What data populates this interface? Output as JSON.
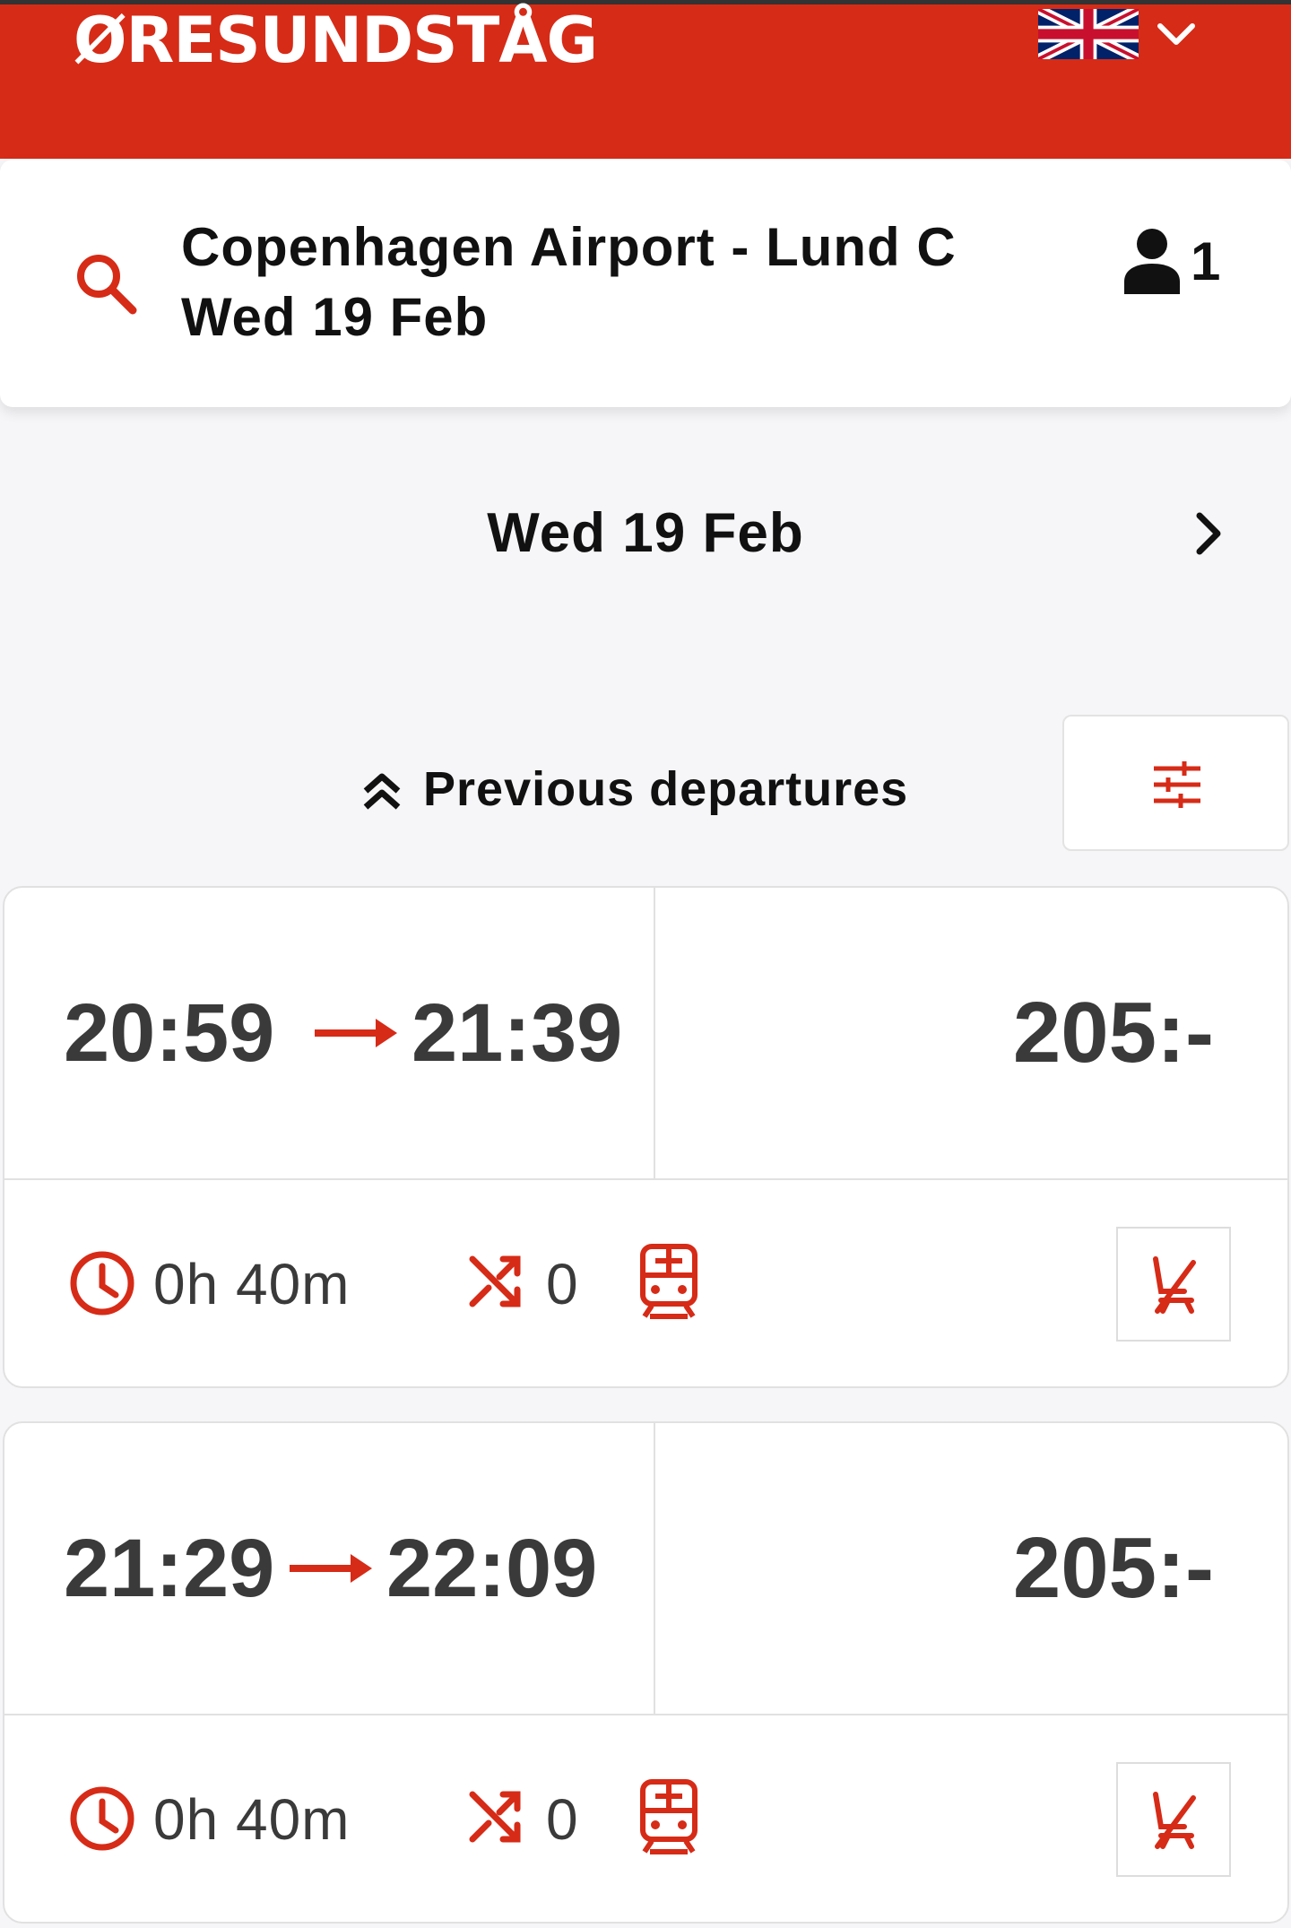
{
  "header": {
    "logo": "ØRESUNDSTÅG",
    "language_flag": "uk-flag-icon",
    "language_chevron": "chevron-down-icon"
  },
  "search": {
    "route": "Copenhagen Airport - Lund C",
    "date": "Wed 19 Feb",
    "passengers": "1"
  },
  "date_nav": {
    "current_date": "Wed 19 Feb"
  },
  "previous_departures_label": "Previous departures",
  "trips": [
    {
      "departure": "20:59",
      "arrival": "21:39",
      "price": "205:-",
      "duration": "0h 40m",
      "changes": "0"
    },
    {
      "departure": "21:29",
      "arrival": "22:09",
      "price": "205:-",
      "duration": "0h 40m",
      "changes": "0"
    }
  ],
  "colors": {
    "brand_red": "#d62b17",
    "background": "#f6f6f8",
    "text_dark": "#3a3a3a"
  }
}
